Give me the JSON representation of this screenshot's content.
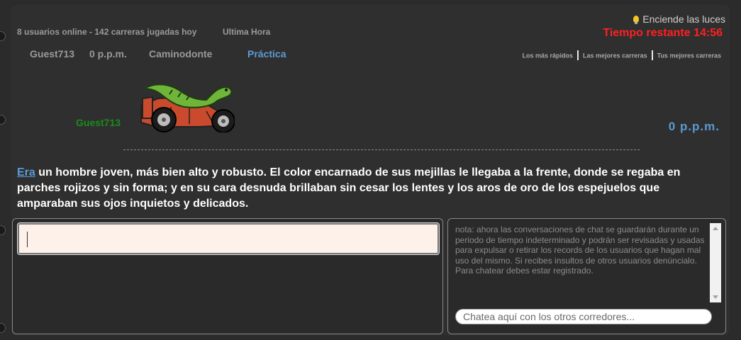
{
  "header": {
    "lights_label": "Enciende las luces",
    "stats": "8 usuarios online - 142 carreras jugadas hoy",
    "last_hour": "Ultima Hora",
    "timer": "Tiempo restante 14:56"
  },
  "player": {
    "name": "Guest713",
    "wpm": "0 p.p.m.",
    "car": "Caminodonte",
    "mode": "Práctica"
  },
  "top_links": [
    "Los más rápidos",
    "Las mejores carreras",
    "Tus mejores carreras"
  ],
  "race": {
    "racer_name": "Guest713",
    "wpm": "0 p.p.m.",
    "current_word": "Era",
    "rest_text": " un hombre joven, más bien alto y robusto. El color encarnado de sus mejillas le llegaba a la frente, donde se regaba en parches rojizos y sin forma; y en su cara desnuda brillaban sin cesar los lentes y los aros de oro de los espejuelos que amparaban sus ojos inquietos y delicados."
  },
  "chat": {
    "notice": "nota: ahora las conversaciones de chat se guardarán durante un periodo de tiempo indeterminado y podrán ser revisadas y usadas para expulsar o retirar los records de los usuarios que hagan mal uso del mismo. Si recibes insultos de otros usuarios denúncialo. Para chatear debes estar registrado.",
    "placeholder": "Chatea aquí con los otros corredores..."
  },
  "colors": {
    "timer": "#ff2020",
    "racer_name": "#1a8c1a",
    "accent_blue": "#5b9bd5",
    "typing_bg": "#fdf1ea"
  },
  "icons": [
    "lightbulb-icon",
    "race-car-dinosaur-icon"
  ]
}
